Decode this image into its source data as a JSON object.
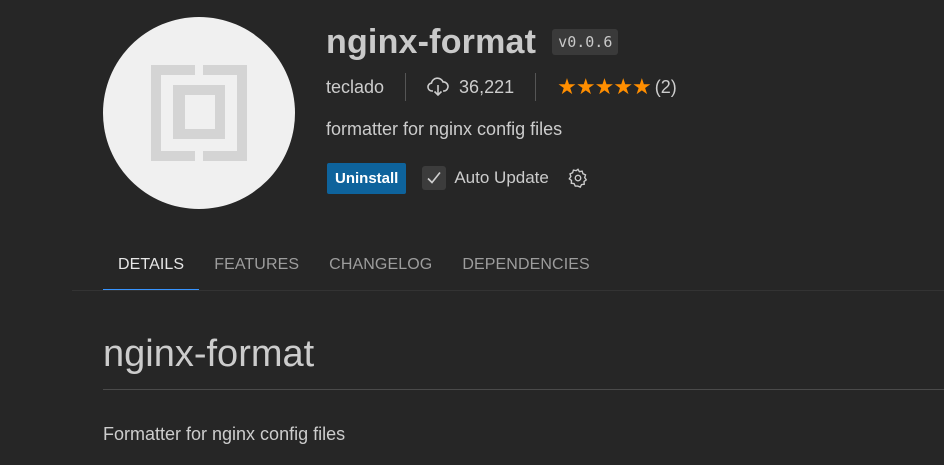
{
  "extension": {
    "name": "nginx-format",
    "version": "v0.0.6",
    "publisher": "teclado",
    "downloads": "36,221",
    "rating_stars": 5,
    "rating_count": "(2)",
    "description": "formatter for nginx config files",
    "logo_icon": "extension-logo-icon"
  },
  "actions": {
    "uninstall_label": "Uninstall",
    "auto_update_label": "Auto Update",
    "auto_update_checked": true
  },
  "tabs": [
    {
      "label": "DETAILS",
      "active": true
    },
    {
      "label": "FEATURES",
      "active": false
    },
    {
      "label": "CHANGELOG",
      "active": false
    },
    {
      "label": "DEPENDENCIES",
      "active": false
    }
  ],
  "readme": {
    "title": "nginx-format",
    "text": "Formatter for nginx config files"
  },
  "colors": {
    "accent": "#0e639c",
    "star": "#ff8e00",
    "active_tab_underline": "#3794ff"
  }
}
